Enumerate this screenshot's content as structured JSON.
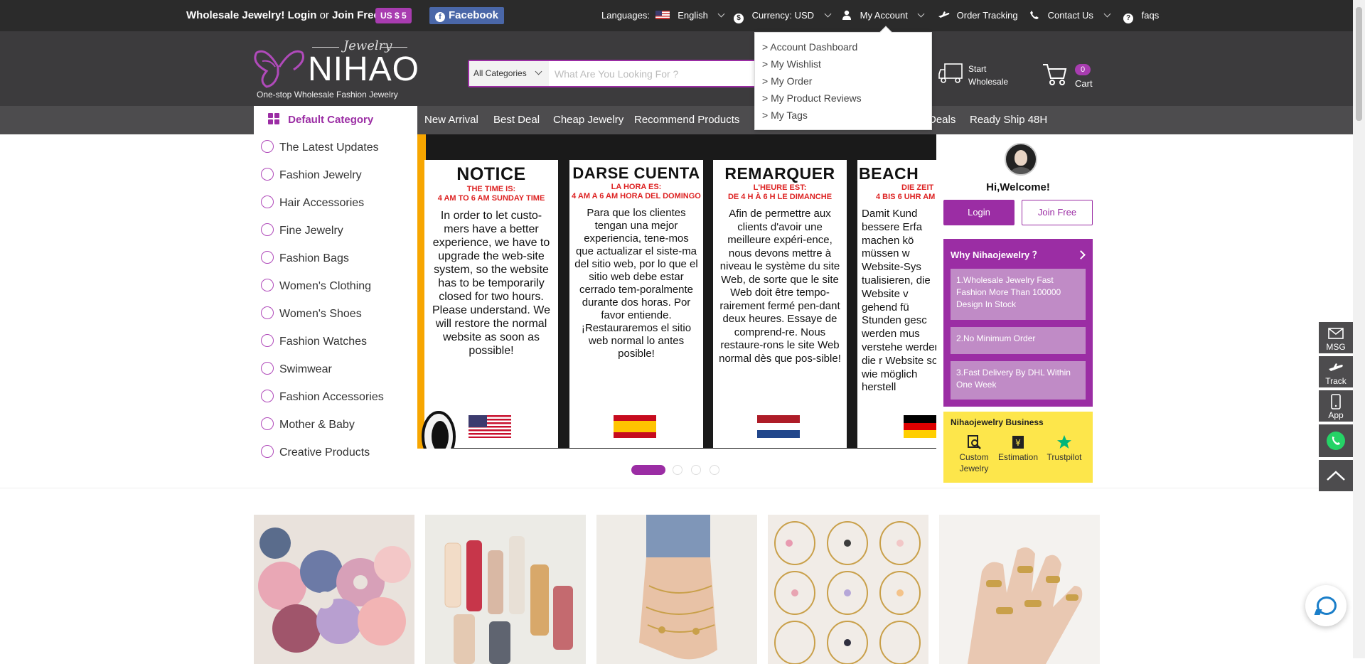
{
  "topbar": {
    "promo_prefix": "Wholesale Jewelry!",
    "login": "Login",
    "or": "or",
    "join": "Join Free",
    "coupon": "US $ 5",
    "facebook": "Facebook",
    "languages_label": "Languages:",
    "language": "English",
    "currency": "Currency: USD",
    "account": "My Account",
    "order_tracking": "Order Tracking",
    "contact": "Contact Us",
    "faqs": "faqs"
  },
  "header": {
    "logo_script": "Jewelry",
    "logo_word": "NIHAO",
    "logo_tagline": "One-stop Wholesale Fashion Jewelry",
    "search_category": "All Categories",
    "search_placeholder": "What Are You Looking For ?",
    "start": "Start",
    "wholesale": "Wholesale",
    "cart_count": "0",
    "cart_label": "Cart"
  },
  "nav": {
    "default_category": "Default Category",
    "links": [
      "New Arrival",
      "Best Deal",
      "Cheap Jewelry",
      "Recommend Products",
      "Deals",
      "Ready Ship 48H"
    ]
  },
  "account_menu": [
    "> Account Dashboard",
    "> My Wishlist",
    "> My Order",
    "> My Product Reviews",
    "> My Tags"
  ],
  "categories": [
    "The Latest Updates",
    "Fashion Jewelry",
    "Hair Accessories",
    "Fine Jewelry",
    "Fashion Bags",
    "Women's Clothing",
    "Women's Shoes",
    "Fashion Watches",
    "Swimwear",
    "Fashion Accessories",
    "Mother & Baby",
    "Creative Products"
  ],
  "banner": {
    "cards": [
      {
        "title": "NOTICE",
        "t1": "THE TIME IS:",
        "t2": "4 AM TO 6 AM SUNDAY TIME",
        "body": "In order to let custo-mers have a better experience, we have to upgrade the web-site system, so the website has to be temporarily closed for two hours. Please understand. We will restore the normal website as soon as possible!"
      },
      {
        "title": "DARSE CUENTA",
        "t1": "LA HORA ES:",
        "t2": "4 AM A 6 AM HORA DEL DOMINGO",
        "body": "Para que los clientes tengan una mejor experiencia, tene-mos que actualizar el siste-ma del sitio web, por lo que el sitio web debe estar cerrado tem-poralmente durante dos horas. Por favor entiende. ¡Restauraremos el sitio web normal lo antes posible!"
      },
      {
        "title": "REMARQUER",
        "t1": "L'HEURE EST:",
        "t2": "DE 4 H À 6 H LE DIMANCHE",
        "body": "Afin de permettre aux clients d'avoir une meilleure expéri-ence, nous devons mettre à niveau le système du site Web, de sorte que le site Web doit être tempo-rairement fermé pen-dant deux heures. Essaye de comprend-re. Nous restaure-rons le site Web normal dès que pos-sible!"
      },
      {
        "title": "BEACH",
        "t1": "DIE ZEIT",
        "t2": "4 BIS 6 UHR AM",
        "body": "Damit Kund bessere Erfa machen kö müssen w Website-Sys tualisieren, die Website v gehend fü Stunden gesc werden mus verstehe werden die r Website so wie möglich herstell"
      }
    ]
  },
  "welcome": {
    "greeting": "Hi,Welcome!",
    "login": "Login",
    "join": "Join Free",
    "why_title": "Why Nihaojewelry ？",
    "why_points": [
      "1.Wholesale Jewelry Fast Fashion More Than 100000 Design In Stock",
      "2.No Minimum Order",
      "3.Fast Delivery By DHL Within One Week"
    ],
    "biz_title": "Nihaojewelry Business",
    "biz_items": [
      "Custom Jewelry",
      "Estimation",
      "Trustpilot"
    ]
  },
  "side_buttons": [
    "MSG",
    "Track",
    "App"
  ],
  "colors": {
    "brand": "#9b2da4",
    "topbar": "#2b2b2b",
    "header": "#3c3b3d",
    "navbar": "#4d4c4e",
    "biz": "#fde64b"
  }
}
